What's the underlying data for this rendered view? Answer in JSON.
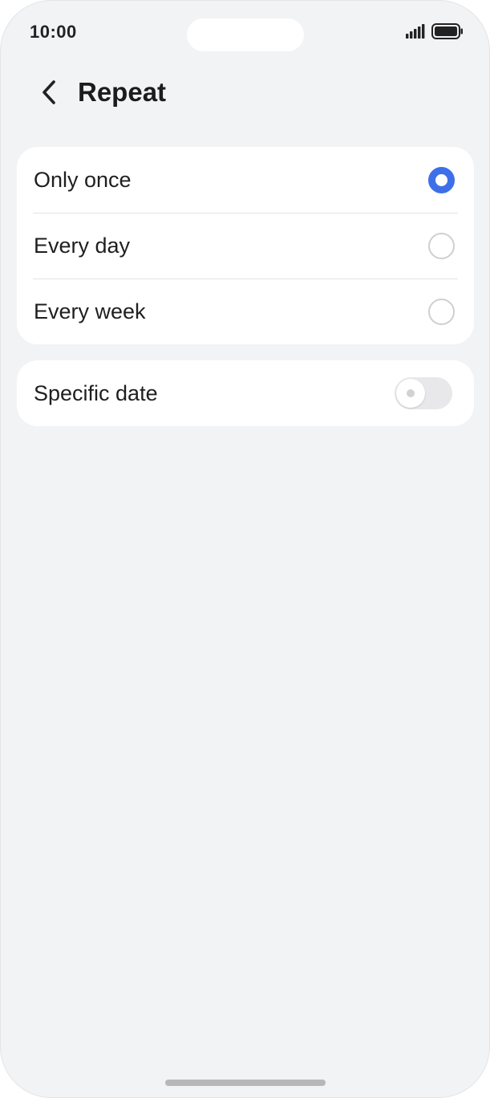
{
  "status_bar": {
    "time": "10:00",
    "signal_icon": "cellular-signal-icon",
    "battery_icon": "battery-full-icon"
  },
  "header": {
    "back_icon": "chevron-left-icon",
    "title": "Repeat"
  },
  "repeat_options": [
    {
      "label": "Only once",
      "selected": true
    },
    {
      "label": "Every day",
      "selected": false
    },
    {
      "label": "Every week",
      "selected": false
    }
  ],
  "specific_date": {
    "label": "Specific date",
    "enabled": false
  },
  "colors": {
    "accent": "#3f6fe8",
    "background": "#f2f3f5",
    "card": "#ffffff"
  }
}
